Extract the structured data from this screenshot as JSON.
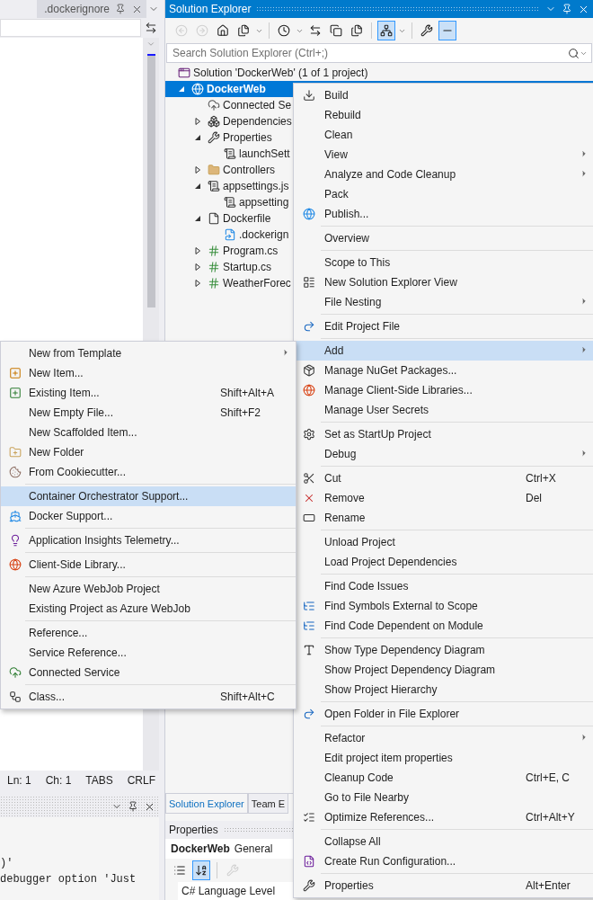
{
  "editor": {
    "tab": {
      "title": ".dockerignore"
    },
    "status": [
      "Ln: 1",
      "Ch: 1",
      "TABS",
      "CRLF"
    ],
    "output_lines": [
      ")'",
      "debugger option 'Just"
    ]
  },
  "solution_explorer": {
    "title": "Solution Explorer",
    "toolbar": [
      {
        "disabled": true,
        "selected": false
      },
      {
        "disabled": true,
        "selected": false
      },
      {
        "disabled": false,
        "selected": false
      },
      {
        "disabled": false,
        "selected": false
      },
      {
        "disabled": false,
        "selected": false
      },
      {
        "disabled": false,
        "selected": false
      },
      {
        "disabled": false,
        "selected": false
      },
      {
        "disabled": false,
        "selected": false
      },
      {
        "disabled": false,
        "selected": true
      },
      {
        "disabled": false,
        "selected": false
      },
      {
        "disabled": false,
        "selected": true
      }
    ],
    "search": {
      "placeholder": "Search Solution Explorer (Ctrl+;)"
    },
    "tree": [
      {
        "label": "Solution 'DockerWeb' (1 of 1 project)",
        "kind": "solution",
        "selected": false,
        "children": [
          {
            "label": "DockerWeb",
            "kind": "project",
            "expanded": true,
            "selected": true,
            "children": [
              {
                "label": "Connected Se",
                "kind": "connected",
                "selected": false
              },
              {
                "label": "Dependencies",
                "kind": "dependencies",
                "expanded": false,
                "selected": false
              },
              {
                "label": "Properties",
                "kind": "properties",
                "expanded": true,
                "selected": false,
                "children": [
                  {
                    "label": "launchSett",
                    "kind": "json",
                    "selected": false
                  }
                ]
              },
              {
                "label": "Controllers",
                "kind": "folder",
                "expanded": false,
                "selected": false
              },
              {
                "label": "appsettings.js",
                "kind": "json",
                "expanded": true,
                "selected": false,
                "children": [
                  {
                    "label": "appsetting",
                    "kind": "json",
                    "selected": false
                  }
                ]
              },
              {
                "label": "Dockerfile",
                "kind": "file",
                "expanded": true,
                "selected": false,
                "children": [
                  {
                    "label": ".dockerign",
                    "kind": "linked",
                    "selected": false
                  }
                ]
              },
              {
                "label": "Program.cs",
                "kind": "csharp",
                "expanded": false,
                "selected": false
              },
              {
                "label": "Startup.cs",
                "kind": "csharp",
                "expanded": false,
                "selected": false
              },
              {
                "label": "WeatherForec",
                "kind": "csharp",
                "expanded": false,
                "selected": false
              }
            ]
          }
        ]
      }
    ],
    "bottom_tabs": [
      {
        "label": "Solution Explorer",
        "selected": true
      },
      {
        "label": "Team E",
        "selected": false
      }
    ]
  },
  "properties": {
    "title": "Properties",
    "object": "DockerWeb",
    "object_type": "General",
    "toolbar": [
      {
        "selected": false,
        "disabled": false
      },
      {
        "selected": true,
        "disabled": false
      },
      {
        "selected": false,
        "disabled": true
      }
    ],
    "rows": [
      "C# Language Level"
    ]
  },
  "context_menu": [
    {
      "kind": "item",
      "label": "Build",
      "selected": false,
      "submenu": false
    },
    {
      "kind": "item",
      "label": "Rebuild",
      "selected": false,
      "submenu": false
    },
    {
      "kind": "item",
      "label": "Clean",
      "selected": false,
      "submenu": false
    },
    {
      "kind": "item",
      "label": "View",
      "selected": false,
      "submenu": true
    },
    {
      "kind": "item",
      "label": "Analyze and Code Cleanup",
      "selected": false,
      "submenu": true
    },
    {
      "kind": "item",
      "label": "Pack",
      "selected": false,
      "submenu": false
    },
    {
      "kind": "item",
      "label": "Publish...",
      "selected": false,
      "submenu": false
    },
    {
      "kind": "separator"
    },
    {
      "kind": "item",
      "label": "Overview",
      "selected": false,
      "submenu": false
    },
    {
      "kind": "separator"
    },
    {
      "kind": "item",
      "label": "Scope to This",
      "selected": false,
      "submenu": false
    },
    {
      "kind": "item",
      "label": "New Solution Explorer View",
      "selected": false,
      "submenu": false
    },
    {
      "kind": "item",
      "label": "File Nesting",
      "selected": false,
      "submenu": true
    },
    {
      "kind": "separator"
    },
    {
      "kind": "item",
      "label": "Edit Project File",
      "selected": false,
      "submenu": false
    },
    {
      "kind": "separator"
    },
    {
      "kind": "item",
      "label": "Add",
      "selected": true,
      "submenu": true
    },
    {
      "kind": "item",
      "label": "Manage NuGet Packages...",
      "selected": false,
      "submenu": false
    },
    {
      "kind": "item",
      "label": "Manage Client-Side Libraries...",
      "selected": false,
      "submenu": false
    },
    {
      "kind": "item",
      "label": "Manage User Secrets",
      "selected": false,
      "submenu": false
    },
    {
      "kind": "separator"
    },
    {
      "kind": "item",
      "label": "Set as StartUp Project",
      "selected": false,
      "submenu": false
    },
    {
      "kind": "item",
      "label": "Debug",
      "selected": false,
      "submenu": true
    },
    {
      "kind": "separator"
    },
    {
      "kind": "item",
      "label": "Cut",
      "shortcut": "Ctrl+X",
      "selected": false,
      "submenu": false
    },
    {
      "kind": "item",
      "label": "Remove",
      "shortcut": "Del",
      "selected": false,
      "submenu": false
    },
    {
      "kind": "item",
      "label": "Rename",
      "selected": false,
      "submenu": false
    },
    {
      "kind": "separator"
    },
    {
      "kind": "item",
      "label": "Unload Project",
      "selected": false,
      "submenu": false
    },
    {
      "kind": "item",
      "label": "Load Project Dependencies",
      "selected": false,
      "submenu": false
    },
    {
      "kind": "separator"
    },
    {
      "kind": "item",
      "label": "Find Code Issues",
      "selected": false,
      "submenu": false
    },
    {
      "kind": "item",
      "label": "Find Symbols External to Scope",
      "selected": false,
      "submenu": false
    },
    {
      "kind": "item",
      "label": "Find Code Dependent on Module",
      "selected": false,
      "submenu": false
    },
    {
      "kind": "separator"
    },
    {
      "kind": "item",
      "label": "Show Type Dependency Diagram",
      "selected": false,
      "submenu": false
    },
    {
      "kind": "item",
      "label": "Show Project Dependency Diagram",
      "selected": false,
      "submenu": false
    },
    {
      "kind": "item",
      "label": "Show Project Hierarchy",
      "selected": false,
      "submenu": false
    },
    {
      "kind": "separator"
    },
    {
      "kind": "item",
      "label": "Open Folder in File Explorer",
      "selected": false,
      "submenu": false
    },
    {
      "kind": "separator"
    },
    {
      "kind": "item",
      "label": "Refactor",
      "selected": false,
      "submenu": true
    },
    {
      "kind": "item",
      "label": "Edit project item properties",
      "selected": false,
      "submenu": false
    },
    {
      "kind": "item",
      "label": "Cleanup Code",
      "shortcut": "Ctrl+E, C",
      "selected": false,
      "submenu": false
    },
    {
      "kind": "item",
      "label": "Go to File Nearby",
      "selected": false,
      "submenu": false
    },
    {
      "kind": "item",
      "label": "Optimize References...",
      "shortcut": "Ctrl+Alt+Y",
      "selected": false,
      "submenu": false
    },
    {
      "kind": "separator"
    },
    {
      "kind": "item",
      "label": "Collapse All",
      "selected": false,
      "submenu": false
    },
    {
      "kind": "item",
      "label": "Create Run Configuration...",
      "selected": false,
      "submenu": false
    },
    {
      "kind": "separator"
    },
    {
      "kind": "item",
      "label": "Properties",
      "shortcut": "Alt+Enter",
      "selected": false,
      "submenu": false
    }
  ],
  "add_submenu": [
    {
      "kind": "item",
      "label": "New from Template",
      "selected": false,
      "submenu": true
    },
    {
      "kind": "item",
      "label": "New Item...",
      "selected": false,
      "submenu": false
    },
    {
      "kind": "item",
      "label": "Existing Item...",
      "shortcut": "Shift+Alt+A",
      "selected": false,
      "submenu": false
    },
    {
      "kind": "item",
      "label": "New Empty File...",
      "shortcut": "Shift+F2",
      "selected": false,
      "submenu": false
    },
    {
      "kind": "item",
      "label": "New Scaffolded Item...",
      "selected": false,
      "submenu": false
    },
    {
      "kind": "item",
      "label": "New Folder",
      "selected": false,
      "submenu": false
    },
    {
      "kind": "item",
      "label": "From Cookiecutter...",
      "selected": false,
      "submenu": false
    },
    {
      "kind": "separator"
    },
    {
      "kind": "item",
      "label": "Container Orchestrator Support...",
      "selected": true,
      "submenu": false
    },
    {
      "kind": "item",
      "label": "Docker Support...",
      "selected": false,
      "submenu": false
    },
    {
      "kind": "separator"
    },
    {
      "kind": "item",
      "label": "Application Insights Telemetry...",
      "selected": false,
      "submenu": false
    },
    {
      "kind": "separator"
    },
    {
      "kind": "item",
      "label": "Client-Side Library...",
      "selected": false,
      "submenu": false
    },
    {
      "kind": "separator"
    },
    {
      "kind": "item",
      "label": "New Azure WebJob Project",
      "selected": false,
      "submenu": false
    },
    {
      "kind": "item",
      "label": "Existing Project as Azure WebJob",
      "selected": false,
      "submenu": false
    },
    {
      "kind": "separator"
    },
    {
      "kind": "item",
      "label": "Reference...",
      "selected": false,
      "submenu": false
    },
    {
      "kind": "item",
      "label": "Service Reference...",
      "selected": false,
      "submenu": false
    },
    {
      "kind": "item",
      "label": "Connected Service",
      "selected": false,
      "submenu": false
    },
    {
      "kind": "separator"
    },
    {
      "kind": "item",
      "label": "Class...",
      "shortcut": "Shift+Alt+C",
      "selected": false,
      "submenu": false
    }
  ]
}
